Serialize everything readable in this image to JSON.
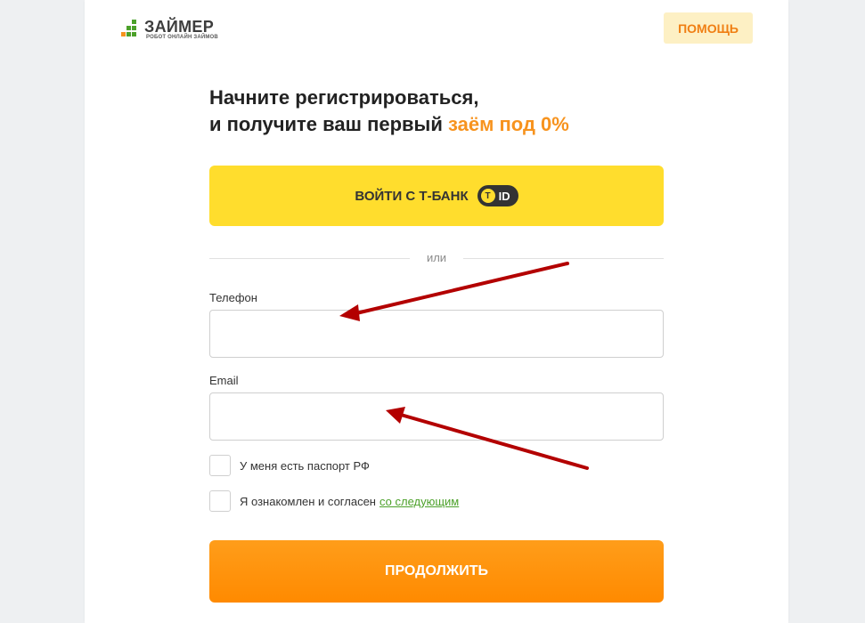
{
  "brand": {
    "name": "ЗАЙМЕР",
    "tagline": "РОБОТ ОНЛАЙН ЗАЙМОВ"
  },
  "header": {
    "help_label": "ПОМОЩЬ"
  },
  "headline": {
    "line1": "Начните регистрироваться,",
    "line2_prefix": "и получите ваш первый",
    "line2_accent": "заём под 0%"
  },
  "tbank": {
    "label": "ВОЙТИ С Т-БАНК",
    "badge_letter": "T",
    "badge_text": "ID"
  },
  "divider": {
    "text": "или"
  },
  "form": {
    "phone_label": "Телефон",
    "phone_value": "",
    "email_label": "Email",
    "email_value": "",
    "passport_label": "У меня есть паспорт РФ",
    "agree_label": "Я ознакомлен и согласен",
    "agree_link": "со следующим",
    "continue_label": "ПРОДОЛЖИТЬ"
  },
  "colors": {
    "accent_orange": "#f7931e",
    "tbank_yellow": "#ffdd2d",
    "help_bg": "#fdf0c4",
    "link_green": "#4ca12a",
    "annotation_arrow": "#b30000"
  }
}
